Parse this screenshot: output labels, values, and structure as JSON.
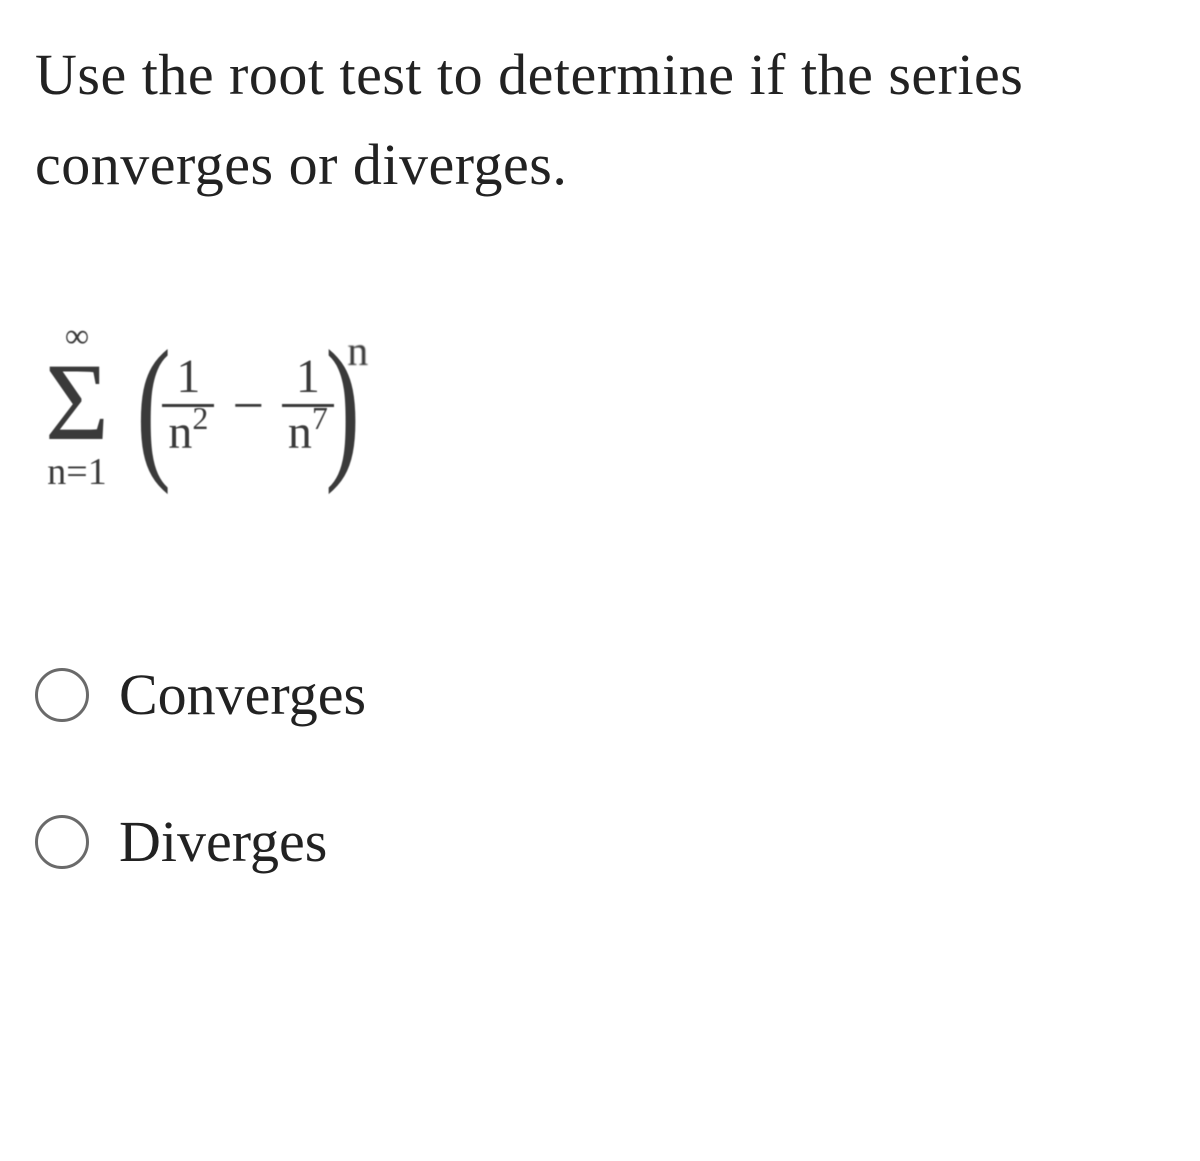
{
  "question": {
    "text": "Use the root test to determine if the series converges or diverges."
  },
  "formula": {
    "sigma_upper": "∞",
    "sigma_symbol": "Σ",
    "sigma_lower": "n=1",
    "frac1_num": "1",
    "frac1_den_base": "n",
    "frac1_den_exp": "2",
    "minus": "−",
    "frac2_num": "1",
    "frac2_den_base": "n",
    "frac2_den_exp": "7",
    "outer_exp": "n"
  },
  "options": [
    {
      "label": "Converges"
    },
    {
      "label": "Diverges"
    }
  ]
}
